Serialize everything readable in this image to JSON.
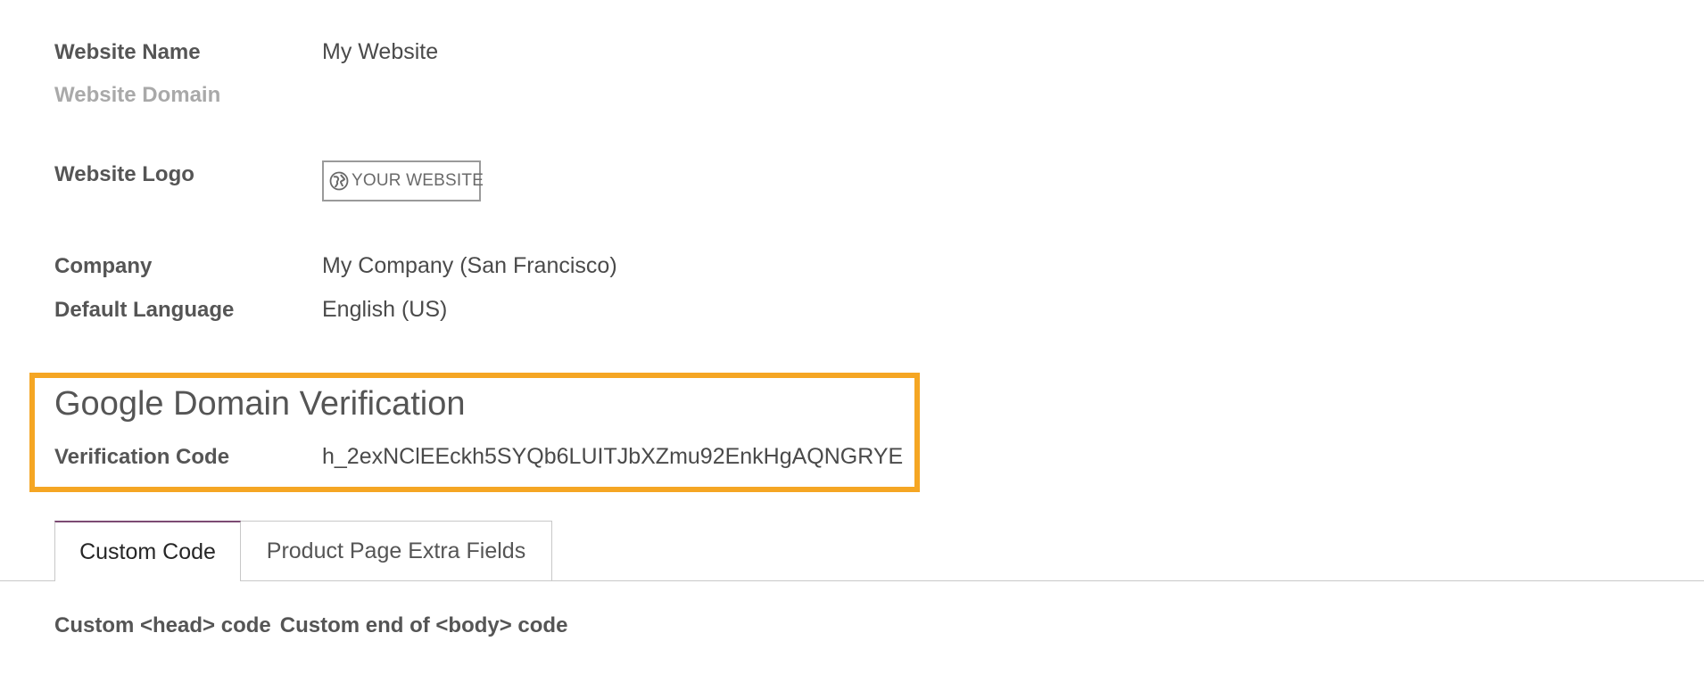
{
  "settings": {
    "website_name": {
      "label": "Website Name",
      "value": "My Website"
    },
    "website_domain": {
      "label": "Website Domain",
      "value": ""
    },
    "website_logo": {
      "label": "Website Logo",
      "logo_text": "YOUR WEBSITE",
      "icon": "globe-icon"
    },
    "company": {
      "label": "Company",
      "value": "My Company (San Francisco)"
    },
    "default_language": {
      "label": "Default Language",
      "value": "English (US)"
    }
  },
  "google_verification": {
    "title": "Google Domain Verification",
    "label": "Verification Code",
    "value": "h_2exNClEEckh5SYQb6LUITJbXZmu92EnkHgAQNGRYE",
    "highlight_color": "#f5a623"
  },
  "tabs": [
    {
      "label": "Custom Code",
      "active": true
    },
    {
      "label": "Product Page Extra Fields",
      "active": false
    }
  ],
  "custom_code": {
    "head_label": "Custom <head> code",
    "body_label": "Custom end of <body> code"
  },
  "colors": {
    "tab_active_accent": "#7c4a73",
    "muted_label": "#a9a9a9"
  }
}
